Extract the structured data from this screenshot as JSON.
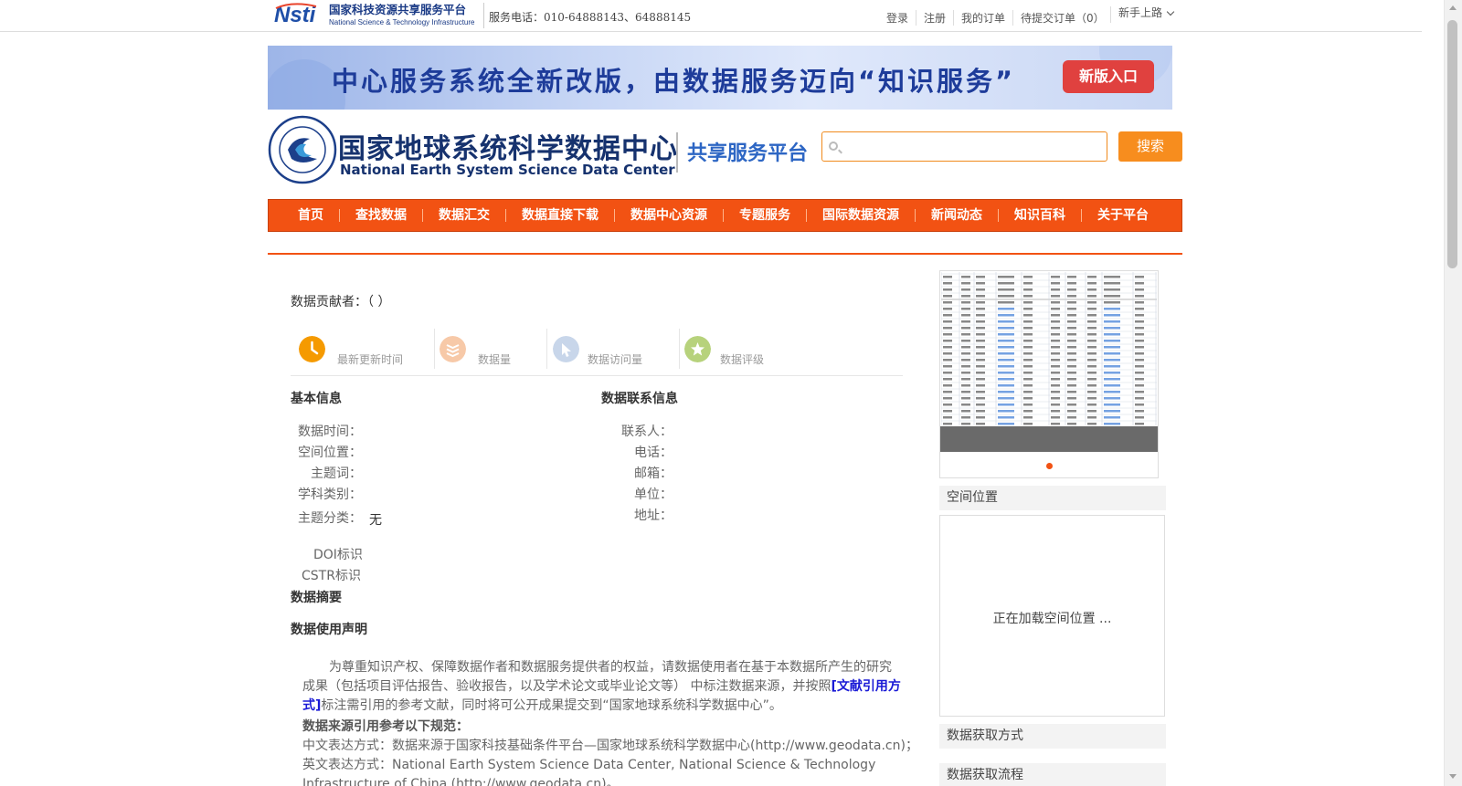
{
  "topbar": {
    "logo_cn": "国家科技资源共享服务平台",
    "logo_en": "National Science & Technology Infrastructure",
    "service_phone": "服务电话：010-64888143、64888145",
    "links": [
      "登录",
      "注册",
      "我的订单",
      "待提交订单（0）"
    ],
    "newbie": "新手上路"
  },
  "banner": {
    "text": "中心服务系统全新改版，由数据服务迈向“知识服务”",
    "button": "新版入口"
  },
  "header": {
    "title_cn": "国家地球系统科学数据中心",
    "title_en": "National Earth System Science Data Center",
    "platform": "共享服务平台",
    "search_placeholder": "",
    "search_button": "搜索"
  },
  "nav": {
    "items": [
      "首页",
      "查找数据",
      "数据汇交",
      "数据直接下载",
      "数据中心资源",
      "专题服务",
      "国际数据资源",
      "新闻动态",
      "知识百科",
      "关于平台"
    ]
  },
  "main": {
    "contributor": "数据贡献者：（ ）",
    "stats": [
      {
        "label": "最新更新时间",
        "icon": "clock-icon",
        "color": "#f59a00"
      },
      {
        "label": "数据量",
        "icon": "database-icon",
        "color": "#f7c9a8"
      },
      {
        "label": "数据访问量",
        "icon": "cursor-icon",
        "color": "#c8d6ea"
      },
      {
        "label": "数据评级",
        "icon": "star-icon",
        "color": "#b7d27c"
      }
    ],
    "basic_info": {
      "title": "基本信息",
      "data_time": "数据时间：",
      "location": "空间位置：",
      "keywords": "主题词：",
      "discipline": "学科类别：",
      "theme": "主题分类：",
      "theme_value": "无",
      "doi": "DOI标识",
      "cstr": "CSTR标识"
    },
    "contact_info": {
      "title": "数据联系信息",
      "contact": "联系人：",
      "phone": "电话：",
      "email": "邮箱：",
      "unit": "单位：",
      "address": "地址："
    },
    "abstract_title": "数据摘要",
    "usage": {
      "title": "数据使用声明",
      "text_before": "为尊重知识产权、保障数据作者和数据服务提供者的权益，请数据使用者在基于本数据所产生的研究成果（包括项目评估报告、验收报告，以及学术论文或毕业论文等） 中标注数据来源，并按照",
      "cite_link": "[文献引用方式]",
      "text_after": "标注需引用的参考文献，同时将可公开成果提交到“国家地球系统科学数据中心”。",
      "ref_title": "数据来源引用参考以下规范：",
      "ref_cn": "中文表达方式：数据来源于国家科技基础条件平台—国家地球系统科学数据中心(http://www.geodata.cn)；",
      "ref_en_1": "英文表达方式：National Earth System Science Data Center, National Science & Technology",
      "ref_en_2": "Infrastructure of China (http://www.geodata.cn)。"
    }
  },
  "sidebar": {
    "spatial_title": "空间位置",
    "spatial_loading": "正在加载空间位置 ...",
    "access_method": "数据获取方式",
    "access_process": "数据获取流程"
  },
  "colors": {
    "nav_orange": "#f25213",
    "search_orange": "#f78d1e",
    "banner_button": "#e0413f",
    "title_navy": "#16326e",
    "platform_blue": "#2d66c4"
  }
}
